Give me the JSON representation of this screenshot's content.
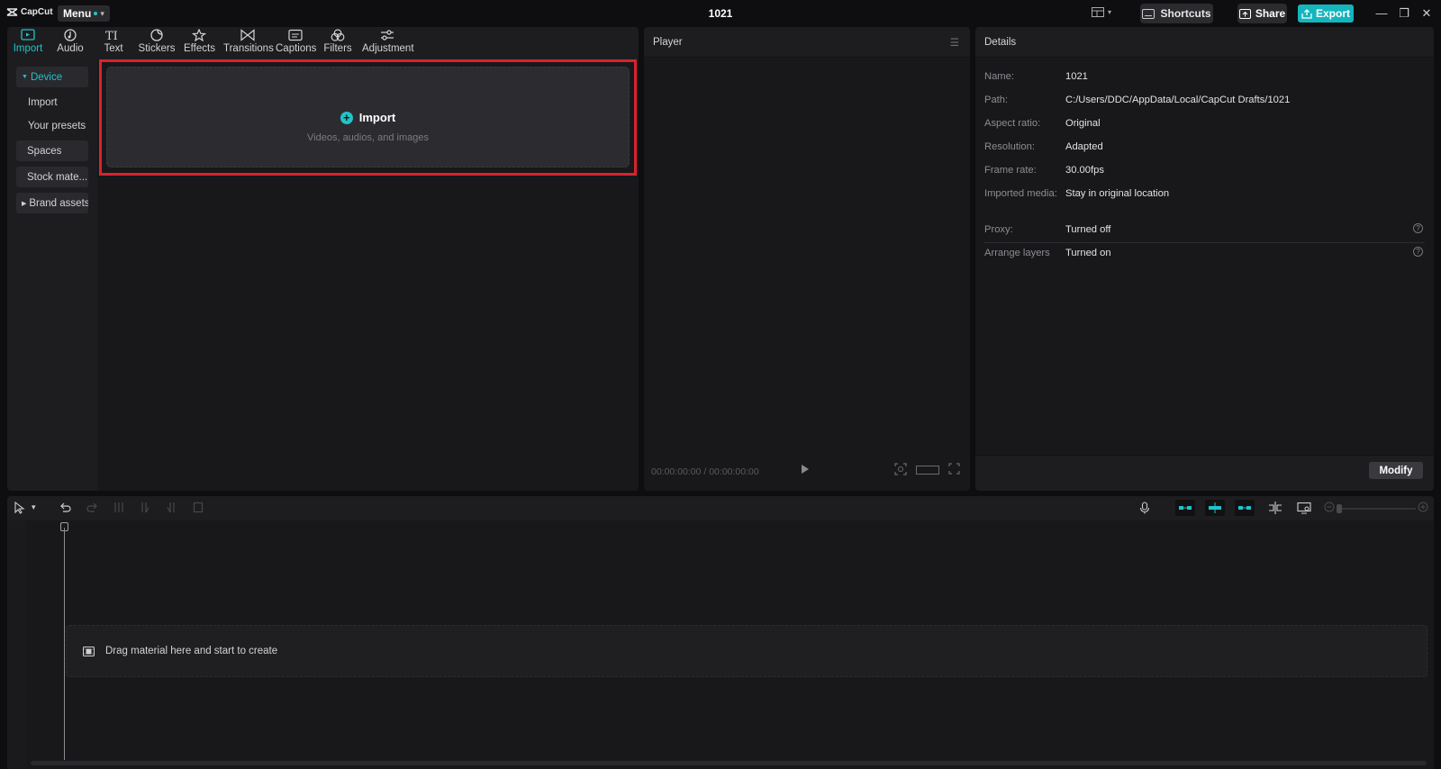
{
  "app": {
    "brand": "CapCut",
    "menu_label": "Menu",
    "project_title": "1021",
    "shortcuts_label": "Shortcuts",
    "share_label": "Share",
    "export_label": "Export",
    "accent_color": "#21c3c9"
  },
  "toolbar": {
    "tabs": [
      {
        "label": "Import",
        "icon": "import-icon",
        "active": true
      },
      {
        "label": "Audio",
        "icon": "audio-icon"
      },
      {
        "label": "Text",
        "icon": "text-icon"
      },
      {
        "label": "Stickers",
        "icon": "stickers-icon"
      },
      {
        "label": "Effects",
        "icon": "effects-icon"
      },
      {
        "label": "Transitions",
        "icon": "transitions-icon"
      },
      {
        "label": "Captions",
        "icon": "captions-icon"
      },
      {
        "label": "Filters",
        "icon": "filters-icon"
      },
      {
        "label": "Adjustment",
        "icon": "adjustment-icon"
      }
    ]
  },
  "sidebar": {
    "items": [
      {
        "label": "Device",
        "active": true
      },
      {
        "label": "Import"
      },
      {
        "label": "Your presets"
      },
      {
        "label": "Spaces"
      },
      {
        "label": "Stock mate..."
      },
      {
        "label": "Brand assets"
      }
    ]
  },
  "import_zone": {
    "title": "Import",
    "subtitle": "Videos, audios, and images"
  },
  "player": {
    "title": "Player",
    "time": "00:00:00:00 / 00:00:00:00"
  },
  "details": {
    "title": "Details",
    "rows": [
      {
        "key": "Name:",
        "value": "1021"
      },
      {
        "key": "Path:",
        "value": "C:/Users/DDC/AppData/Local/CapCut Drafts/1021"
      },
      {
        "key": "Aspect ratio:",
        "value": "Original"
      },
      {
        "key": "Resolution:",
        "value": "Adapted"
      },
      {
        "key": "Frame rate:",
        "value": "30.00fps"
      },
      {
        "key": "Imported media:",
        "value": "Stay in original location"
      },
      {
        "key": "Proxy:",
        "value": "Turned off"
      },
      {
        "key": "Arrange layers",
        "value": "Turned on"
      }
    ],
    "modify_label": "Modify"
  },
  "timeline": {
    "drop_hint": "Drag material here and start to create"
  }
}
